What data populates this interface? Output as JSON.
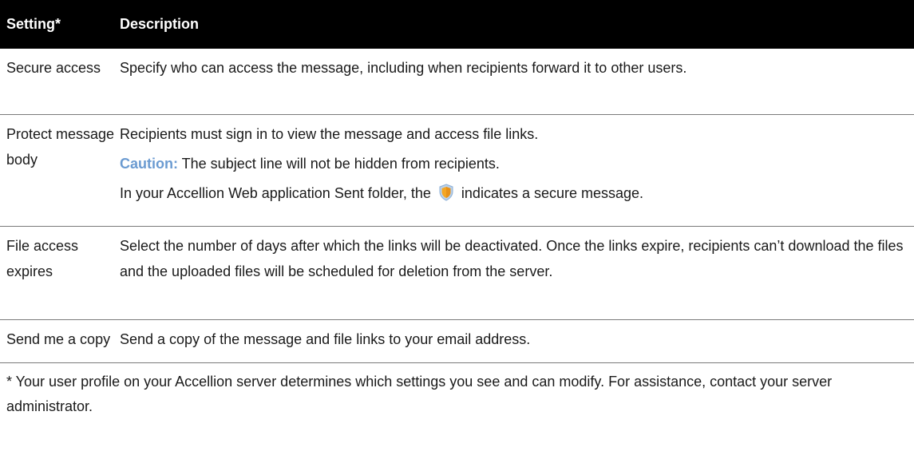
{
  "table": {
    "headers": {
      "setting": "Setting*",
      "description": "Description"
    },
    "rows": [
      {
        "setting": "Secure access",
        "description": "Specify who can access the message, including when recipients forward it to other users."
      },
      {
        "setting": "Protect message body",
        "description": "Recipients must sign in to view the message and access file links.",
        "caution_label": "Caution:",
        "caution_text": " The subject line will not be hidden from recipients.",
        "sent_folder_before": "In your Accellion Web application Sent folder, the ",
        "sent_folder_icon": "shield-icon",
        "sent_folder_after": " indicates a secure message."
      },
      {
        "setting": "File access expires",
        "description": "Select the number of days after which the links will be deactivated. Once the links expire, recipients can’t download the files and the uploaded files will be scheduled for deletion from the server."
      },
      {
        "setting": "Send me a copy",
        "description": "Send a copy of the message and file links to your email address."
      }
    ]
  },
  "footnote": "* Your user profile on your Accellion server determines which settings you see and can modify. For assistance, contact your server administrator.",
  "colors": {
    "header_background": "#000000",
    "header_text": "#ffffff",
    "caution": "#6b9bd1",
    "shield": "#f5a623"
  }
}
